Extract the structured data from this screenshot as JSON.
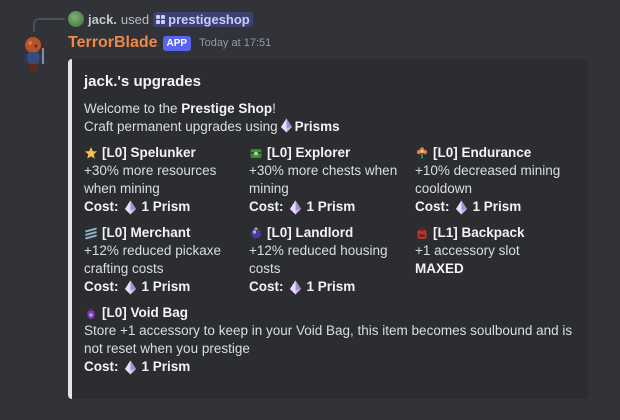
{
  "reply": {
    "username": "jack.",
    "used_text": "used",
    "command": "prestigeshop"
  },
  "message": {
    "author": "TerrorBlade",
    "badge": "APP",
    "timestamp": "Today at 17:51"
  },
  "embed": {
    "title": "jack.'s upgrades",
    "welcome_prefix": "Welcome to the ",
    "welcome_bold": "Prestige Shop",
    "welcome_suffix": "!",
    "craft_prefix": "Craft permanent upgrades using",
    "craft_bold": "Prisms",
    "accent_color": "#e3e5e8",
    "fields": [
      {
        "icon": "star-icon",
        "name": "[L0] Spelunker",
        "desc": "+30% more resources when mining",
        "cost_label": "Cost:",
        "cost": "1 Prism"
      },
      {
        "icon": "chest-icon",
        "name": "[L0] Explorer",
        "desc": "+30% more chests when mining",
        "cost_label": "Cost:",
        "cost": "1 Prism"
      },
      {
        "icon": "flower-icon",
        "name": "[L0] Endurance",
        "desc": "+10% decreased mining cooldown",
        "cost_label": "Cost:",
        "cost": "1 Prism"
      },
      {
        "icon": "scroll-icon",
        "name": "[L0] Merchant",
        "desc": "+12% reduced pickaxe crafting costs",
        "cost_label": "Cost:",
        "cost": "1 Prism"
      },
      {
        "icon": "orb-icon",
        "name": "[L0] Landlord",
        "desc": "+12% reduced housing costs",
        "cost_label": "Cost:",
        "cost": "1 Prism"
      },
      {
        "icon": "backpack-icon",
        "name": "[L1] Backpack",
        "desc": "+1 accessory slot",
        "status": "MAXED"
      },
      {
        "icon": "void-bag-icon",
        "name": "[L0] Void Bag",
        "desc": "Store +1 accessory to keep in your Void Bag, this item becomes soulbound and is not reset when you prestige",
        "cost_label": "Cost:",
        "cost": "1 Prism"
      }
    ]
  }
}
